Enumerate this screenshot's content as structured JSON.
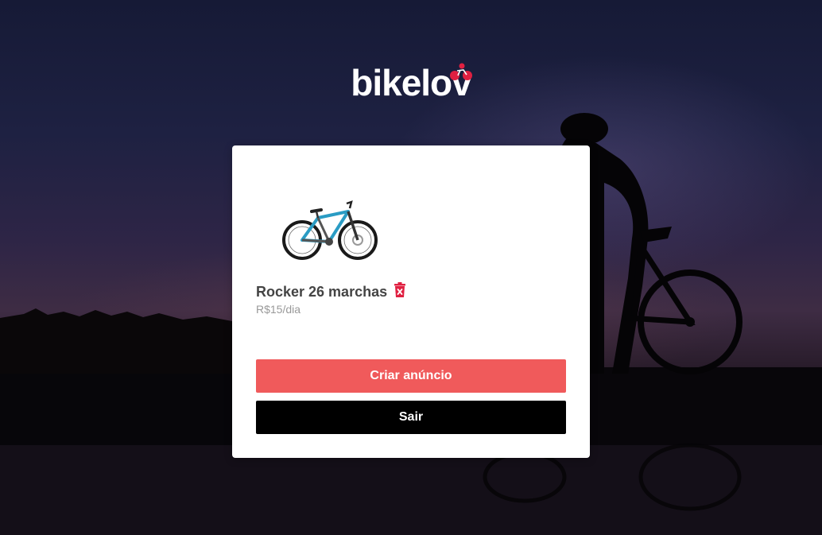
{
  "brand": {
    "logo_text": "bikelov",
    "accent_color": "#e02041"
  },
  "background": {
    "description_icon": "cyclist-silhouette-sunset"
  },
  "listing": {
    "image_icon": "mountain-bike-image",
    "name": "Rocker 26 marchas",
    "price": "R$15/dia",
    "delete_icon": "trash-icon"
  },
  "actions": {
    "create_label": "Criar anúncio",
    "create_color": "#f05a5b",
    "logout_label": "Sair",
    "logout_color": "#000000"
  }
}
